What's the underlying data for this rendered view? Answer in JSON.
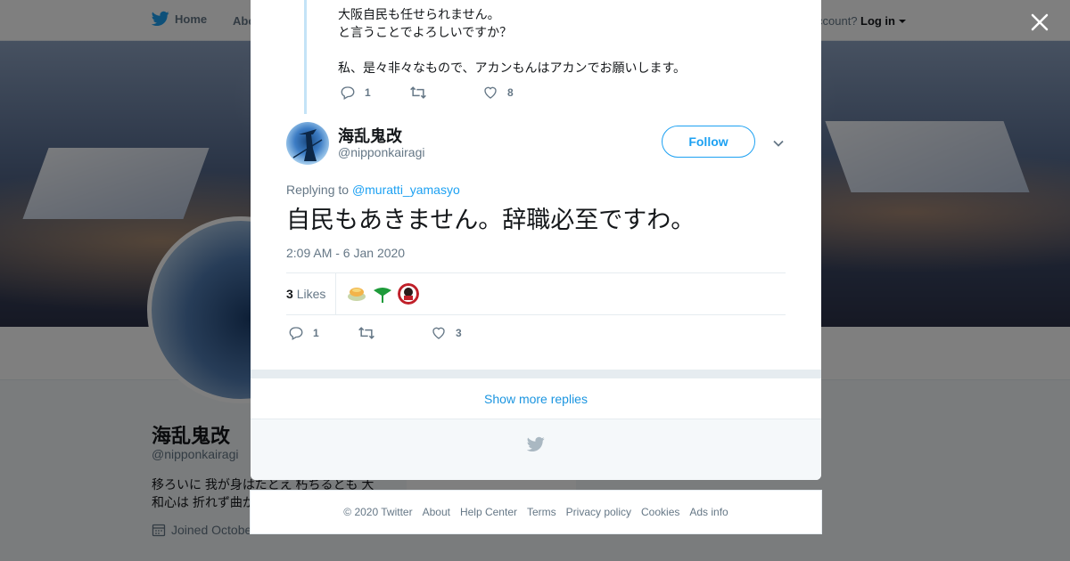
{
  "nav": {
    "home_label": "Home",
    "about_label": "Abo",
    "account_prompt": "ccount?",
    "login_label": "Log in"
  },
  "background_profile": {
    "name": "海乱鬼改",
    "handle": "@nipponkairagi",
    "bio_line1": "移ろいに 我が身はたとえ 朽ちるとも 大",
    "bio_line2": "和心は 折れず曲が",
    "joined": "Joined Octobe",
    "ads_info": "Ads info"
  },
  "previous_tweet": {
    "lines": [
      "大阪自民も任せられません。",
      "と言うことでよろしいですか？",
      "",
      "私、是々非々なもので、アカンもんはアカンでお願いします。"
    ],
    "reply_count": "1",
    "like_count": "8"
  },
  "tweet": {
    "name": "海乱鬼改",
    "handle": "@nipponkairagi",
    "follow_label": "Follow",
    "replying_prefix": "Replying to",
    "replying_mention": "@muratti_yamasyo",
    "text": "自民もあきません。辞職必至ですわ。",
    "timestamp": "2:09 AM - 6 Jan 2020",
    "likes_count": "3",
    "likes_label": "Likes",
    "reply_count": "1",
    "like_count": "3",
    "show_more": "Show more replies"
  },
  "footer": {
    "links": [
      "© 2020 Twitter",
      "About",
      "Help Center",
      "Terms",
      "Privacy policy",
      "Cookies",
      "Ads info"
    ]
  },
  "colors": {
    "twitter_blue": "#1da1f2",
    "link_blue": "#1b95e0",
    "muted_text": "#657786",
    "border": "#e6ecf0"
  },
  "icons": [
    "twitter-bird-icon",
    "close-icon",
    "reply-icon",
    "retweet-icon",
    "heart-icon",
    "chevron-down-icon",
    "calendar-icon",
    "caret-down-icon"
  ]
}
